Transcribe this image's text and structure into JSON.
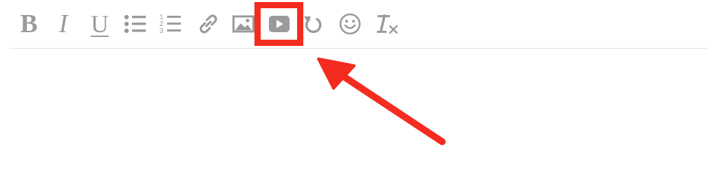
{
  "toolbar": {
    "bold_label": "B",
    "italic_label": "I",
    "underline_label": "U",
    "buttons": [
      {
        "name": "bold",
        "icon": "bold-icon"
      },
      {
        "name": "italic",
        "icon": "italic-icon"
      },
      {
        "name": "underline",
        "icon": "underline-icon"
      },
      {
        "name": "bulleted-list",
        "icon": "bulleted-list-icon"
      },
      {
        "name": "numbered-list",
        "icon": "numbered-list-icon"
      },
      {
        "name": "link",
        "icon": "link-icon"
      },
      {
        "name": "image",
        "icon": "image-icon"
      },
      {
        "name": "video",
        "icon": "video-icon"
      },
      {
        "name": "undo",
        "icon": "undo-icon"
      },
      {
        "name": "emoji",
        "icon": "smiley-icon"
      },
      {
        "name": "clear-formatting",
        "icon": "clear-formatting-icon"
      }
    ],
    "icon_color": "#9a9a9a"
  },
  "annotation": {
    "highlighted_button": "video",
    "highlight_color": "#f42b1f",
    "arrow_color": "#f42b1f"
  },
  "editor": {
    "content": ""
  }
}
